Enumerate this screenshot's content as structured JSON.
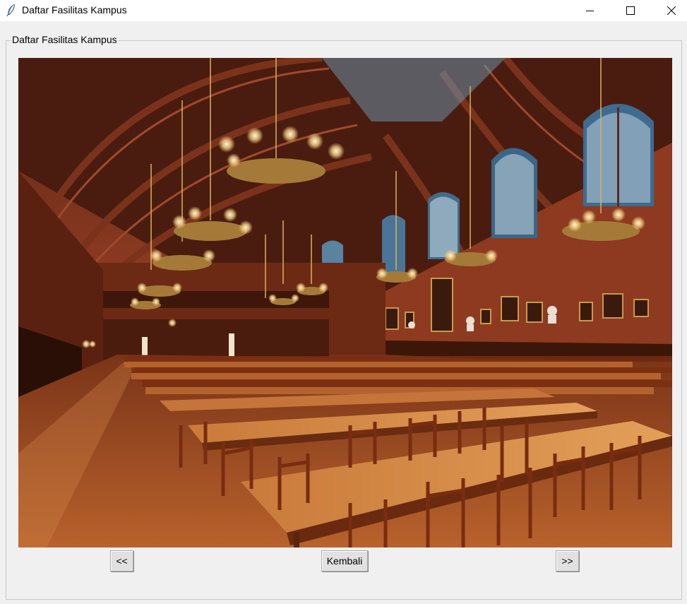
{
  "window": {
    "title": "Daftar Fasilitas Kampus",
    "icon": "feather-icon",
    "controls": [
      "minimize-icon",
      "maximize-icon",
      "close-icon"
    ]
  },
  "frame": {
    "label": "Daftar Fasilitas Kampus"
  },
  "photo": {
    "subject": "dining-hall-photo"
  },
  "buttons": {
    "prev_label": "<<",
    "back_label": "Kembali",
    "next_label": ">>"
  },
  "colors": {
    "window_bg": "#f0f0f0",
    "titlebar_bg": "#ffffff",
    "button_bg": "#e1e1e1",
    "wood": "#8a3a1e"
  }
}
